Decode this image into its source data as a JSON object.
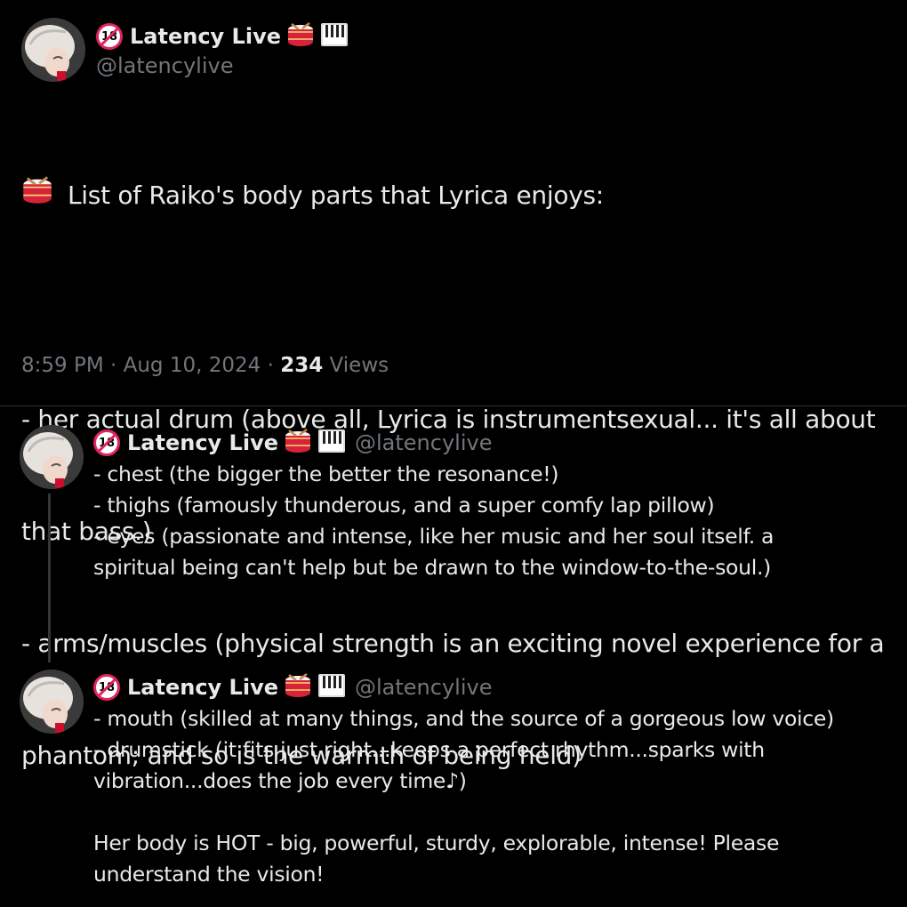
{
  "author": {
    "display_name": "Latency Live",
    "handle": "@latencylive",
    "badge": "18",
    "name_emojis": [
      "drum-icon",
      "piano-keys-icon"
    ]
  },
  "main_post": {
    "lines": [
      "List of Raiko's body parts that Lyrica enjoys:",
      "",
      "- her actual drum  (above all, Lyrica is instrumentsexual... it's all about",
      "that bass.)",
      "- arms/muscles  (physical strength is an exciting novel experience for a",
      "phantom; and so is the warmth of being held)"
    ],
    "time": "8:59 PM",
    "separator1": "·",
    "date": "Aug 10, 2024",
    "separator2": "·",
    "views_count": "234",
    "views_label": "Views"
  },
  "replies": [
    {
      "lines": [
        "- chest  (the bigger the better the resonance!)",
        "- thighs  (famously thunderous, and a super comfy lap pillow)",
        "- eyes  (passionate and intense, like her music and her soul itself.  a",
        "spiritual being can't help but be drawn to the window-to-the-soul.)"
      ]
    },
    {
      "lines": [
        "- mouth (skilled at many things, and the source of a gorgeous low voice)",
        "- drumstick  (it fits just right...keeps a perfect rhythm...sparks with",
        "vibration...does the job every time♪)",
        "",
        "Her body is HOT - big, powerful, sturdy, explorable, intense!  Please",
        "understand the vision!"
      ]
    }
  ]
}
